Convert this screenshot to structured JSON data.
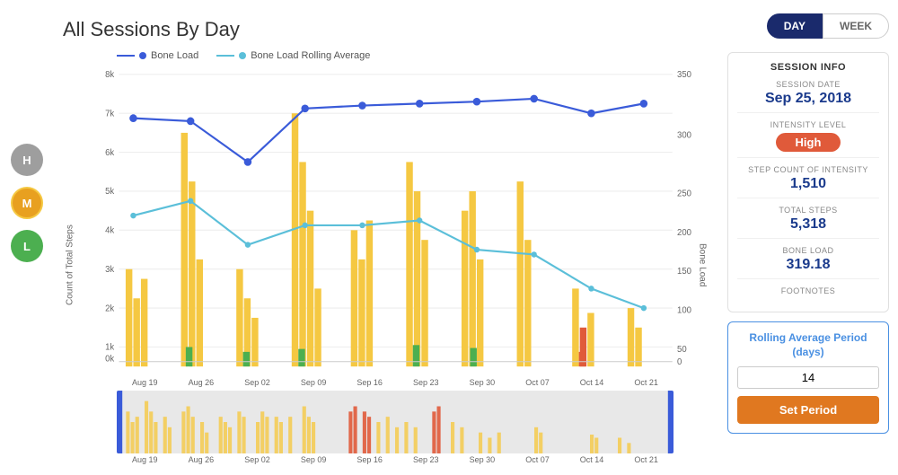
{
  "page": {
    "title": "All Sessions By Day"
  },
  "toggle": {
    "day_label": "DAY",
    "week_label": "WEEK",
    "active": "day"
  },
  "legend": {
    "bone_load_label": "Bone Load",
    "rolling_avg_label": "Bone Load Rolling Average"
  },
  "session_info": {
    "title": "SESSION INFO",
    "session_date_label": "SESSION DATE",
    "session_date_value": "Sep 25, 2018",
    "intensity_label": "INTENSITY LEVEL",
    "intensity_value": "High",
    "step_count_label": "STEP COUNT OF INTENSITY",
    "step_count_value": "1,510",
    "total_steps_label": "TOTAL STEPS",
    "total_steps_value": "5,318",
    "bone_load_label": "BONE LOAD",
    "bone_load_value": "319.18",
    "footnotes_label": "FOOTNOTES"
  },
  "rolling_avg": {
    "title": "Rolling Average Period (days)",
    "input_value": "14",
    "button_label": "Set Period"
  },
  "avatars": [
    {
      "label": "H",
      "color": "#9e9e9e"
    },
    {
      "label": "M",
      "color": "#e8a020"
    },
    {
      "label": "L",
      "color": "#4caf50"
    }
  ],
  "x_labels_main": [
    "Aug 19",
    "Aug 26",
    "Sep 02",
    "Sep 09",
    "Sep 16",
    "Sep 23",
    "Sep 30",
    "Oct 07",
    "Oct 14",
    "Oct 21"
  ],
  "x_labels_mini": [
    "Aug 19",
    "Aug 26",
    "Sep 02",
    "Sep 09",
    "Sep 16",
    "Sep 23",
    "Sep 30",
    "Oct 07",
    "Oct 14",
    "Oct 21"
  ],
  "y_axis_left_label": "Count of Total Steps",
  "y_axis_right_label": "Bone Load",
  "colors": {
    "bar_yellow": "#f5c842",
    "bar_green": "#4caf50",
    "bar_red": "#e05a3a",
    "line_blue": "#3a5bd9",
    "line_teal": "#5bbfd9",
    "active_toggle_bg": "#1a2a6c",
    "intensity_badge": "#e05a3a",
    "set_period_btn": "#e07820",
    "rolling_border": "#4a90e2",
    "info_value_color": "#1a3a8c"
  }
}
